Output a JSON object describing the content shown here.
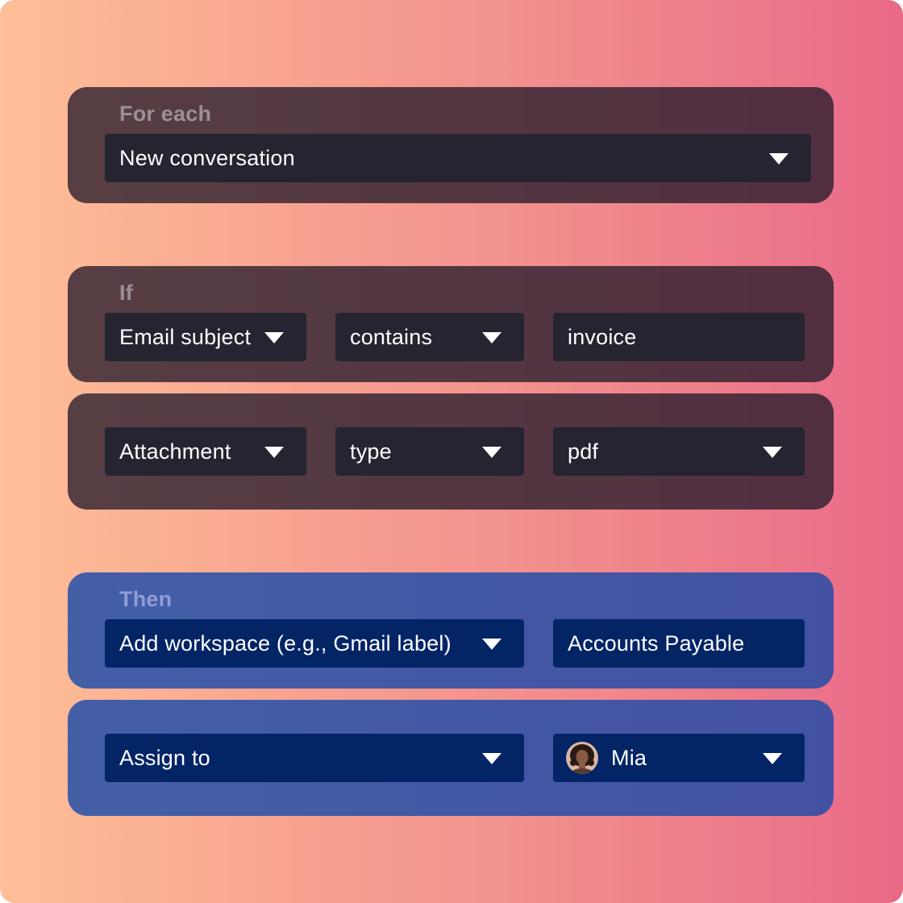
{
  "for_each": {
    "label": "For each",
    "trigger": "New conversation"
  },
  "if": {
    "label": "If",
    "conditions": [
      {
        "field": "Email subject",
        "operator": "contains",
        "value": "invoice"
      },
      {
        "field": "Attachment",
        "operator": "type",
        "value": "pdf"
      }
    ]
  },
  "then": {
    "label": "Then",
    "actions": [
      {
        "action": "Add workspace (e.g., Gmail label)",
        "value": "Accounts Payable"
      },
      {
        "action": "Assign to",
        "value": "Mia",
        "avatar_icon": "user-avatar"
      }
    ]
  },
  "colors": {
    "gradient_start": "#ffbf98",
    "gradient_end": "#e96a88",
    "dark_panel": "#3b2d36",
    "dark_field": "#252430",
    "blue_panel": "#435ba5",
    "blue_field": "#032566"
  }
}
